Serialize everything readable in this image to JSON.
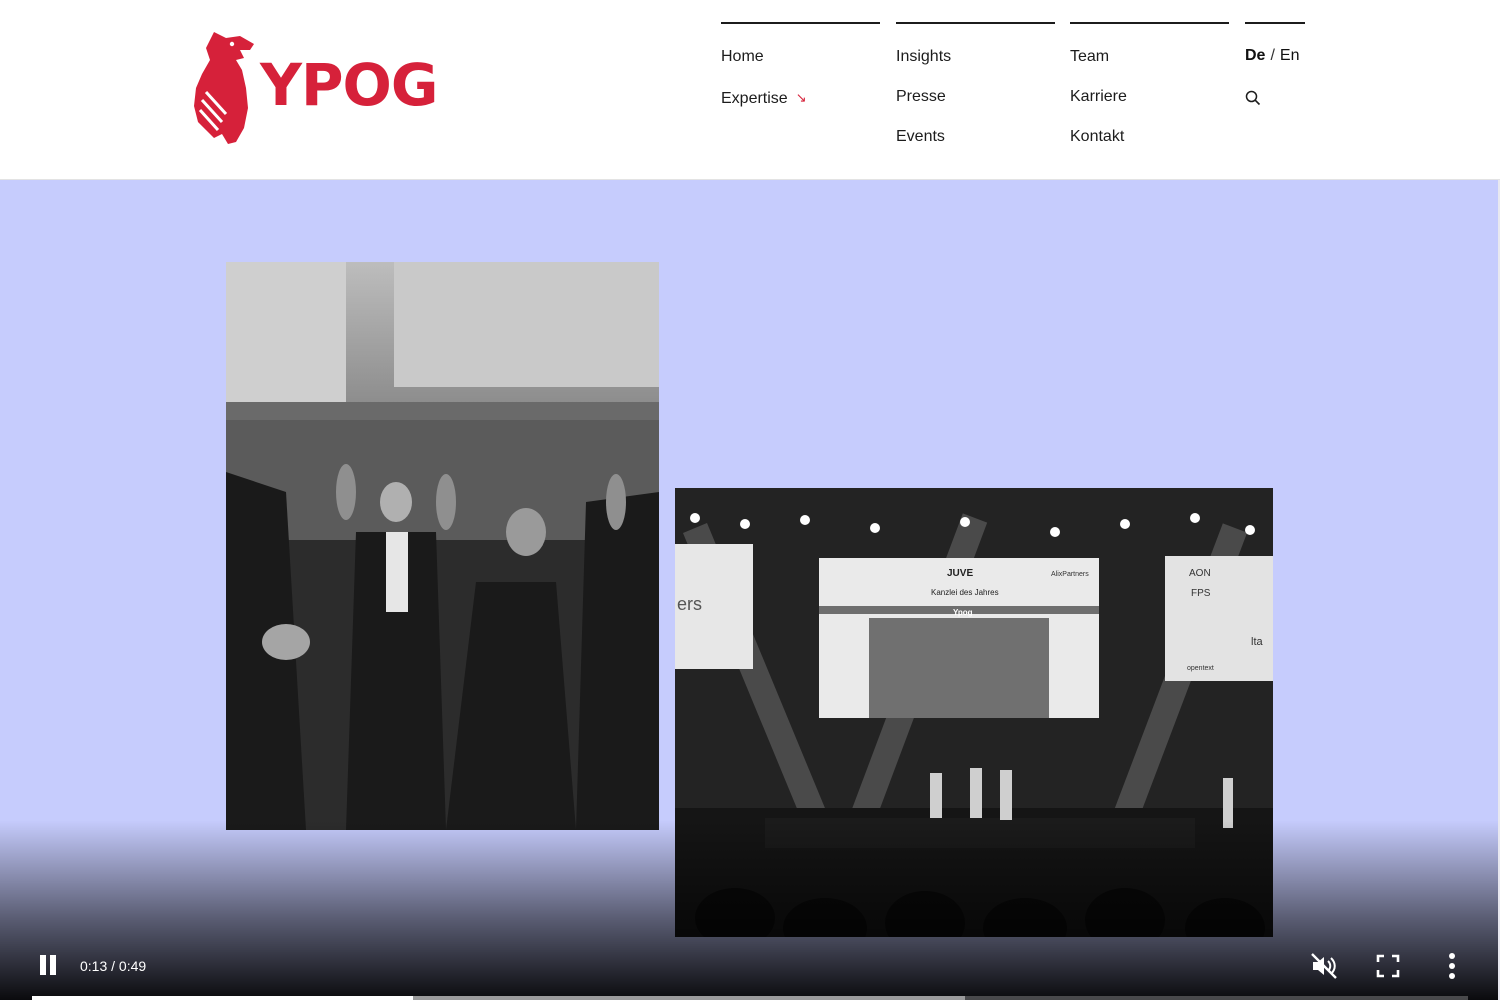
{
  "brand": {
    "name": "YPOG",
    "color": "#d6213a"
  },
  "nav": {
    "col1": [
      "Home",
      "Expertise"
    ],
    "col2": [
      "Insights",
      "Presse",
      "Events"
    ],
    "col3": [
      "Team",
      "Karriere",
      "Kontakt"
    ],
    "lang": {
      "de": "De",
      "sep": "/",
      "en": "En"
    },
    "expertise_icon": "arrow-down-right-icon",
    "search_icon": "search-icon"
  },
  "video": {
    "background": "#c6ccfd",
    "time": "0:13 / 0:49",
    "progress": 0.265,
    "buffered": 0.65,
    "controls": [
      "pause-icon",
      "mute-icon",
      "fullscreen-icon",
      "more-vertical-icon"
    ]
  },
  "stage_screen": {
    "juve_label": "JUVE",
    "sponsor_label": "AlixPartners",
    "award_title": "Kanzlei des Jahres",
    "winner": "Ypog",
    "side_fragment": "ers",
    "sponsors": [
      "AON",
      "FPS",
      "lta",
      "opentext"
    ]
  }
}
